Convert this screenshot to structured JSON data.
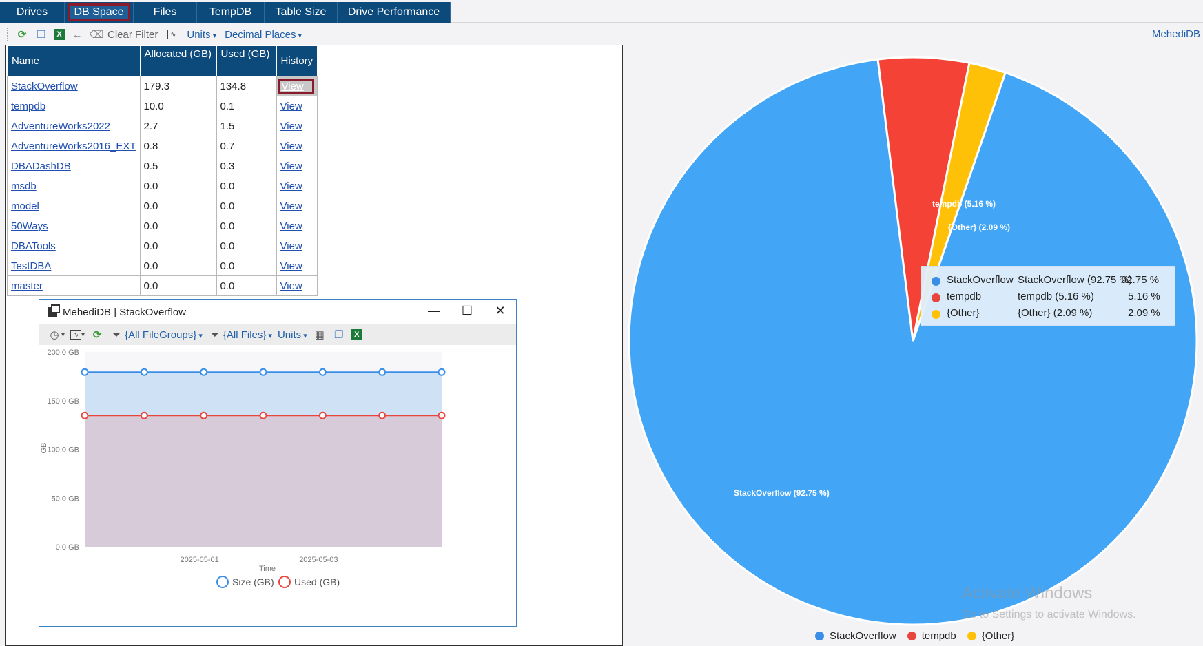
{
  "tabs": [
    {
      "label": "Drives",
      "active": false
    },
    {
      "label": "DB Space",
      "active": true
    },
    {
      "label": "Files",
      "active": false
    },
    {
      "label": "TempDB",
      "active": false
    },
    {
      "label": "Table Size",
      "active": false
    },
    {
      "label": "Drive Performance",
      "active": false
    }
  ],
  "toolbar": {
    "clear_filter": "Clear Filter",
    "units": "Units",
    "decimal_places": "Decimal Places",
    "server": "MehediDB"
  },
  "grid": {
    "headers": {
      "name": "Name",
      "allocated": "Allocated (GB)",
      "used": "Used (GB)",
      "history": "History"
    },
    "rows": [
      {
        "name": "StackOverflow",
        "allocated": "179.3",
        "used": "134.8",
        "history": "View"
      },
      {
        "name": "tempdb",
        "allocated": "10.0",
        "used": "0.1",
        "history": "View"
      },
      {
        "name": "AdventureWorks2022",
        "allocated": "2.7",
        "used": "1.5",
        "history": "View"
      },
      {
        "name": "AdventureWorks2016_EXT",
        "allocated": "0.8",
        "used": "0.7",
        "history": "View"
      },
      {
        "name": "DBADashDB",
        "allocated": "0.5",
        "used": "0.3",
        "history": "View"
      },
      {
        "name": "msdb",
        "allocated": "0.0",
        "used": "0.0",
        "history": "View"
      },
      {
        "name": "model",
        "allocated": "0.0",
        "used": "0.0",
        "history": "View"
      },
      {
        "name": "50Ways",
        "allocated": "0.0",
        "used": "0.0",
        "history": "View"
      },
      {
        "name": "DBATools",
        "allocated": "0.0",
        "used": "0.0",
        "history": "View"
      },
      {
        "name": "TestDBA",
        "allocated": "0.0",
        "used": "0.0",
        "history": "View"
      },
      {
        "name": "master",
        "allocated": "0.0",
        "used": "0.0",
        "history": "View"
      }
    ]
  },
  "history_window": {
    "title": "MehediDB | StackOverflow",
    "filegroups": "{All FileGroups}",
    "files": "{All Files}",
    "units": "Units"
  },
  "colors": {
    "tab_bg": "#0d4a7c",
    "size_line": "#3a8ee6",
    "used_line": "#e8453c",
    "pie_blue": "#42a5f5",
    "pie_red": "#f44336",
    "pie_yellow": "#ffc107"
  },
  "chart_data": [
    {
      "type": "area",
      "x": [
        "2025-04-29",
        "2025-04-30",
        "2025-05-01",
        "2025-05-02",
        "2025-05-03",
        "2025-05-04",
        "2025-05-05"
      ],
      "x_ticks": [
        "2025-05-01",
        "2025-05-03"
      ],
      "series": [
        {
          "name": "Size (GB)",
          "values": [
            179.3,
            179.3,
            179.3,
            179.3,
            179.3,
            179.3,
            179.3
          ]
        },
        {
          "name": "Used (GB)",
          "values": [
            134.8,
            134.8,
            134.8,
            134.8,
            134.8,
            134.8,
            134.8
          ]
        }
      ],
      "y_ticks": [
        "200.0 GB",
        "150.0 GB",
        "100.0 GB",
        "50.0 GB",
        "0.0 GB"
      ],
      "ylim": [
        0,
        200
      ],
      "xlabel": "Time",
      "ylabel": "GB",
      "legend": "bottom"
    },
    {
      "type": "pie",
      "slices": [
        {
          "name": "StackOverflow",
          "value": 92.75,
          "label": "StackOverflow (92.75 %)",
          "pct": "92.75 %"
        },
        {
          "name": "tempdb",
          "value": 5.16,
          "label": "tempdb (5.16 %)",
          "pct": "5.16 %"
        },
        {
          "name": "{Other}",
          "value": 2.09,
          "label": "{Other} (2.09 %)",
          "pct": "2.09 %"
        }
      ],
      "legend": "bottom"
    }
  ],
  "watermark": {
    "line1": "Activate Windows",
    "line2": "Go to Settings to activate Windows."
  }
}
